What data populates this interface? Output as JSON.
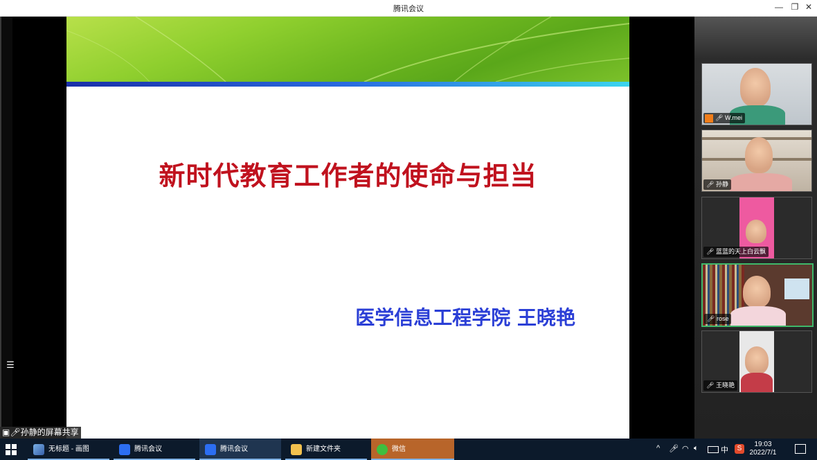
{
  "window": {
    "title": "腾讯会议",
    "minimize": "—",
    "restore": "❐",
    "close": "✕"
  },
  "slide": {
    "title": "新时代教育工作者的使命与担当",
    "author": "医学信息工程学院 王晓艳"
  },
  "share_label": "孙静的屏幕共享",
  "participants": [
    {
      "name": "W.mei"
    },
    {
      "name": "孙静"
    },
    {
      "name": "蓝蓝的天上白云飘"
    },
    {
      "name": "rose"
    },
    {
      "name": "王晓艳"
    }
  ],
  "taskbar": {
    "items": [
      {
        "label": "无标题 - 画图"
      },
      {
        "label": "腾讯会议"
      },
      {
        "label": "腾讯会议"
      },
      {
        "label": "新建文件夹"
      },
      {
        "label": "微信"
      }
    ],
    "tray_ime": "中",
    "time": "19:03",
    "date": "2022/7/1"
  }
}
